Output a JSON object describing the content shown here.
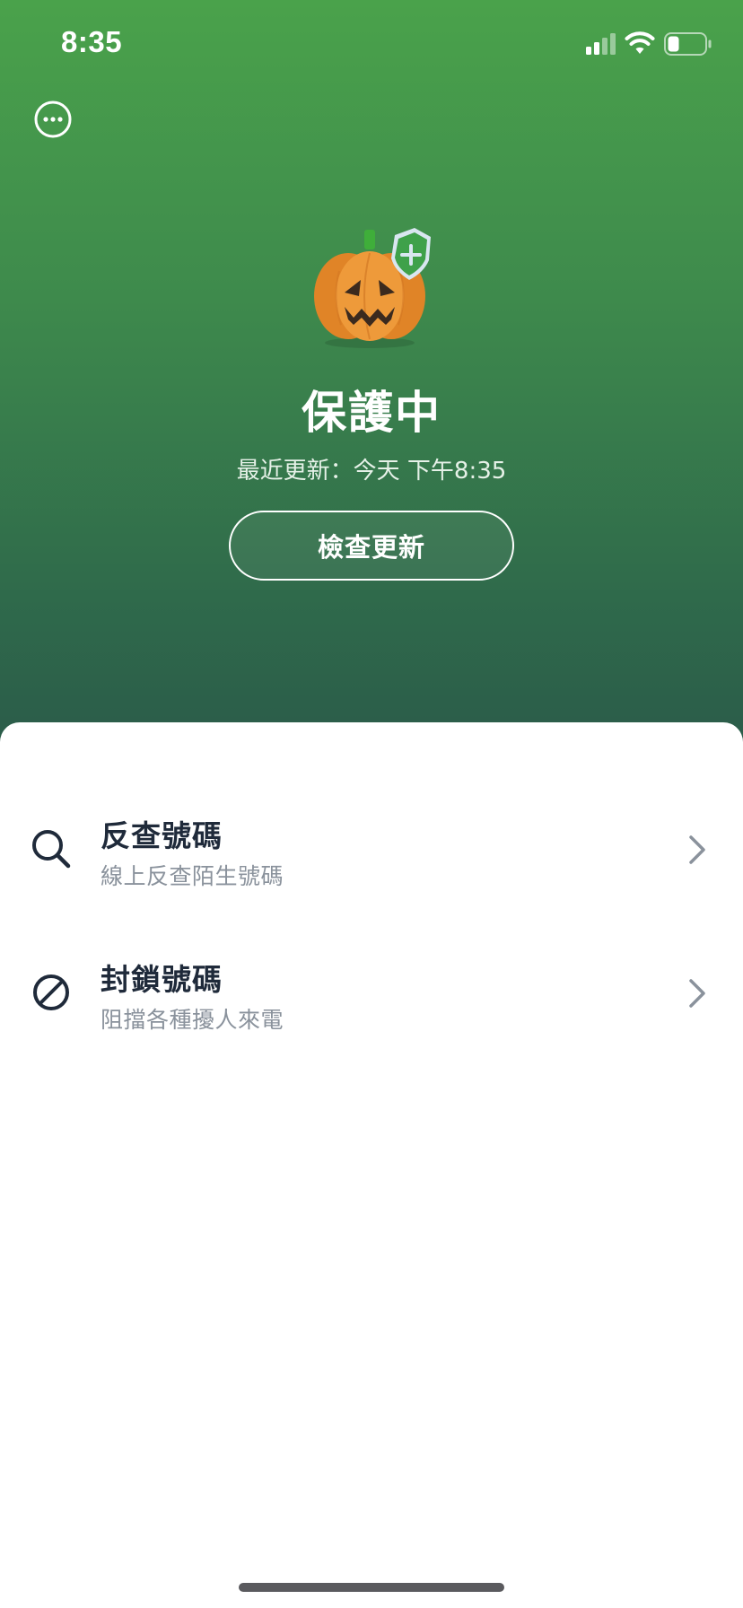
{
  "status_bar": {
    "time": "8:35"
  },
  "header": {
    "more_icon": "more-icon",
    "mascot_icon": "pumpkin-shield-icon",
    "status_title": "保護中",
    "last_update": "最近更新：今天 下午8:35",
    "check_update_label": "檢查更新"
  },
  "menu": {
    "items": [
      {
        "icon": "search-icon",
        "title": "反查號碼",
        "subtitle": "線上反查陌生號碼"
      },
      {
        "icon": "block-icon",
        "title": "封鎖號碼",
        "subtitle": "阻擋各種擾人來電"
      }
    ]
  },
  "colors": {
    "header_gradient_top": "#4aa24b",
    "header_gradient_bottom": "#2b5c4a",
    "title_text": "#1f2a3a",
    "subtitle_text": "#8a929c",
    "pumpkin": "#e8892c",
    "shield": "#3fa14a"
  }
}
